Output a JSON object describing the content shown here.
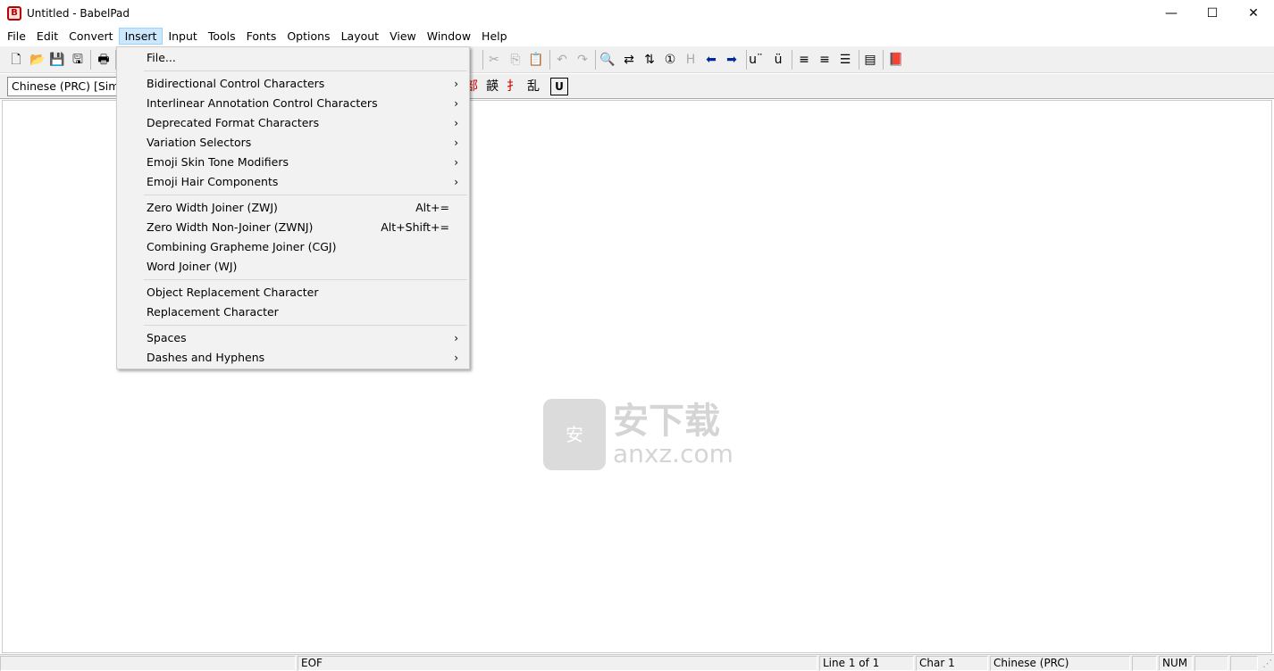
{
  "window": {
    "title": "Untitled - BabelPad",
    "minimize": "—",
    "maximize": "☐",
    "close": "✕"
  },
  "menubar": [
    "File",
    "Edit",
    "Convert",
    "Insert",
    "Input",
    "Tools",
    "Fonts",
    "Options",
    "Layout",
    "View",
    "Window",
    "Help"
  ],
  "toolbar": {
    "icons": [
      "new-file-icon",
      "open-folder-icon",
      "save-icon",
      "save-all-icon",
      "print-icon",
      "cut-icon",
      "copy-icon",
      "paste-icon",
      "undo-icon",
      "redo-icon",
      "find-icon",
      "replace-icon",
      "sort-icon",
      "number-icon",
      "h-icon",
      "arrow-left-icon",
      "arrow-right-icon",
      "combining-diaeresis-icon",
      "u-diaeresis-icon",
      "align-left-icon",
      "align-right-icon",
      "justify-icon",
      "preview-icon",
      "book-icon"
    ]
  },
  "toolbar2": {
    "language": "Chinese (PRC) [Simplified]",
    "glyphs": [
      "部",
      "韺",
      "扌",
      "乱",
      "U"
    ]
  },
  "insert_menu": {
    "groups": [
      [
        {
          "label": "File..."
        }
      ],
      [
        {
          "label": "Bidirectional Control Characters",
          "submenu": true
        },
        {
          "label": "Interlinear Annotation Control Characters",
          "submenu": true
        },
        {
          "label": "Deprecated Format Characters",
          "submenu": true
        },
        {
          "label": "Variation Selectors",
          "submenu": true
        },
        {
          "label": "Emoji Skin Tone Modifiers",
          "submenu": true
        },
        {
          "label": "Emoji Hair Components",
          "submenu": true
        }
      ],
      [
        {
          "label": "Zero Width Joiner (ZWJ)",
          "shortcut": "Alt+="
        },
        {
          "label": "Zero Width Non-Joiner (ZWNJ)",
          "shortcut": "Alt+Shift+="
        },
        {
          "label": "Combining Grapheme Joiner (CGJ)"
        },
        {
          "label": "Word Joiner (WJ)"
        }
      ],
      [
        {
          "label": "Object Replacement Character"
        },
        {
          "label": "Replacement Character"
        }
      ],
      [
        {
          "label": "Spaces",
          "submenu": true
        },
        {
          "label": "Dashes and Hyphens",
          "submenu": true
        }
      ]
    ]
  },
  "watermark": {
    "cn": "安下载",
    "en": "anxz.com",
    "badge": "安"
  },
  "statusbar": [
    "",
    "EOF",
    "Line 1 of 1",
    "Char 1",
    "Chinese (PRC)",
    "",
    "NUM",
    "",
    ""
  ]
}
